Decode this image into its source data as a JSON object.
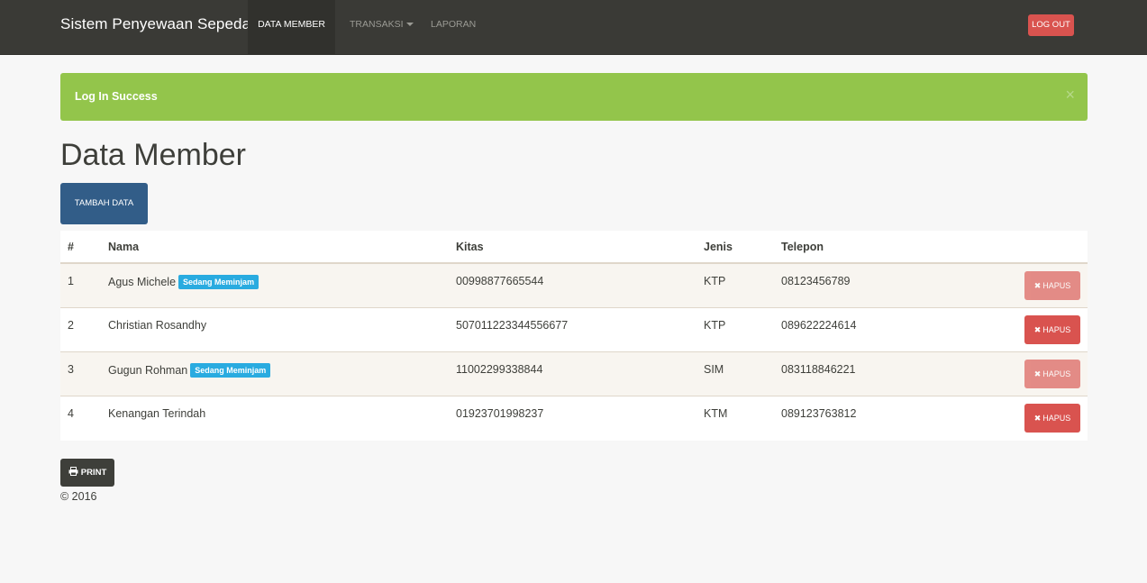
{
  "navbar": {
    "brand": "Sistem Penyewaan Sepeda",
    "items": [
      {
        "label": "DATA MEMBER"
      },
      {
        "label": "TRANSAKSI"
      },
      {
        "label": "LAPORAN"
      }
    ],
    "logout_label": "LOG OUT"
  },
  "alert": {
    "message": "Log In Success",
    "close_glyph": "×"
  },
  "page": {
    "title": "Data Member",
    "add_label": "TAMBAH DATA"
  },
  "table": {
    "headers": [
      "#",
      "Nama",
      "Kitas",
      "Jenis",
      "Telepon"
    ],
    "rows": [
      {
        "no": "1",
        "nama": "Agus Michele",
        "badge": "Sedang Meminjam",
        "kitas": "00998877665544",
        "jenis": "KTP",
        "telepon": "08123456789",
        "action": "HAPUS"
      },
      {
        "no": "2",
        "nama": "Christian Rosandhy",
        "badge": "",
        "kitas": "507011223344556677",
        "jenis": "KTP",
        "telepon": "089622224614",
        "action": "HAPUS"
      },
      {
        "no": "3",
        "nama": "Gugun Rohman",
        "badge": "Sedang Meminjam",
        "kitas": "11002299338844",
        "jenis": "SIM",
        "telepon": "083118846221",
        "action": "HAPUS"
      },
      {
        "no": "4",
        "nama": "Kenangan Terindah",
        "badge": "",
        "kitas": "01923701998237",
        "jenis": "KTM",
        "telepon": "089123763812",
        "action": "HAPUS"
      }
    ]
  },
  "print_label": "PRINT",
  "footer": "© 2016",
  "colors": {
    "navbar": "#3a3a36",
    "alert_success": "#93c54b",
    "primary": "#325d88",
    "danger": "#d9534f",
    "info_badge": "#29abe0",
    "dark": "#3e3f3a"
  },
  "icons": {
    "remove": "remove-icon",
    "print": "print-icon",
    "caret": "caret-down-icon"
  }
}
